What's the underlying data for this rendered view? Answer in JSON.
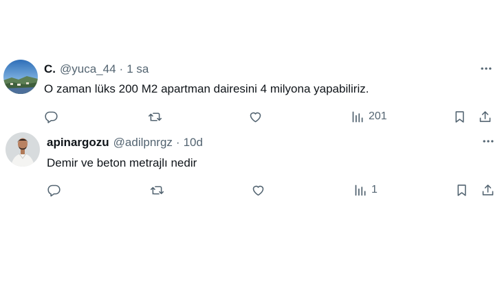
{
  "tweets": [
    {
      "name": "C.",
      "handle": "@yuca_44",
      "separator": "·",
      "time": "1 sa",
      "text": "O zaman lüks 200 M2 apartman dairesini 4 milyona yapabiliriz.",
      "views": "201"
    },
    {
      "name": "apinargozu",
      "handle": "@adilpnrgz",
      "separator": "·",
      "time": "10d",
      "text": "Demir ve beton metrajlı nedir",
      "views": "1"
    }
  ],
  "colors": {
    "text": "#0f1419",
    "muted": "#536471"
  }
}
